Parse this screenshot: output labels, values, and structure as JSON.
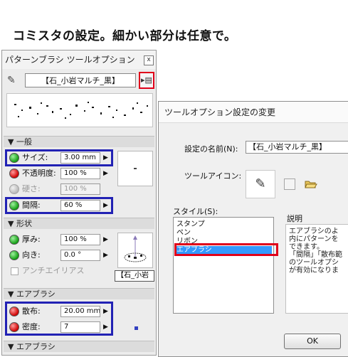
{
  "heading": "コミスタの設定。細かい部分は任意で。",
  "palette": {
    "title": "パターンブラシ ツールオプション",
    "close_label": "x",
    "brush_name": "【石_小岩マルチ_黒】",
    "brush_menu_label": "▸▤",
    "brush_menu_icon": "menu-list-icon",
    "sections": {
      "general": "▼ 一般",
      "shape": "▼ 形状",
      "airbrush": "▼ エアブラシ",
      "airbrush2": "▼ エアブラシ"
    },
    "size": {
      "label": "サイズ:",
      "value": "3.00 mm",
      "arrow": "▶"
    },
    "opacity": {
      "label": "不透明度:",
      "value": "100 %",
      "arrow": "▶"
    },
    "hardness": {
      "label": "硬さ:",
      "value": "100 %"
    },
    "spacing": {
      "label": "間隔:",
      "value": "60 %",
      "arrow": "▶"
    },
    "thickness": {
      "label": "厚み:",
      "value": "100 %",
      "arrow": "▶"
    },
    "direction": {
      "label": "向き:",
      "value": "0.0 °",
      "arrow": "▶"
    },
    "antialias": {
      "label": "アンチエイリアス"
    },
    "brush_tag": "【石_小岩",
    "scatter": {
      "label": "散布:",
      "value": "20.00 mm",
      "arrow": "▶"
    },
    "density": {
      "label": "密度:",
      "value": "7",
      "arrow": "▶"
    }
  },
  "dialog": {
    "title": "ツールオプション設定の変更",
    "name_label": "設定の名前(N):",
    "name_value": "【石_小岩マルチ_黒】",
    "tool_icon_label": "ツールアイコン:",
    "folder_icon": "folder-open-icon",
    "style_label": "スタイル(S):",
    "styles": [
      "スタンプ",
      "ペン",
      "リボン",
      "エアブラシ"
    ],
    "selected_style": "エアブラシ",
    "description_label": "説明",
    "description_lines": [
      "エアブラシのよ",
      "内にパターンを",
      "できます。",
      "「間隔」「散布範",
      "のツールオプシ",
      "が有効になりま"
    ],
    "ok_label": "OK"
  },
  "colors": {
    "highlight_blue": "#2222b4",
    "highlight_red": "#e0001a",
    "selection": "#3399ff"
  }
}
